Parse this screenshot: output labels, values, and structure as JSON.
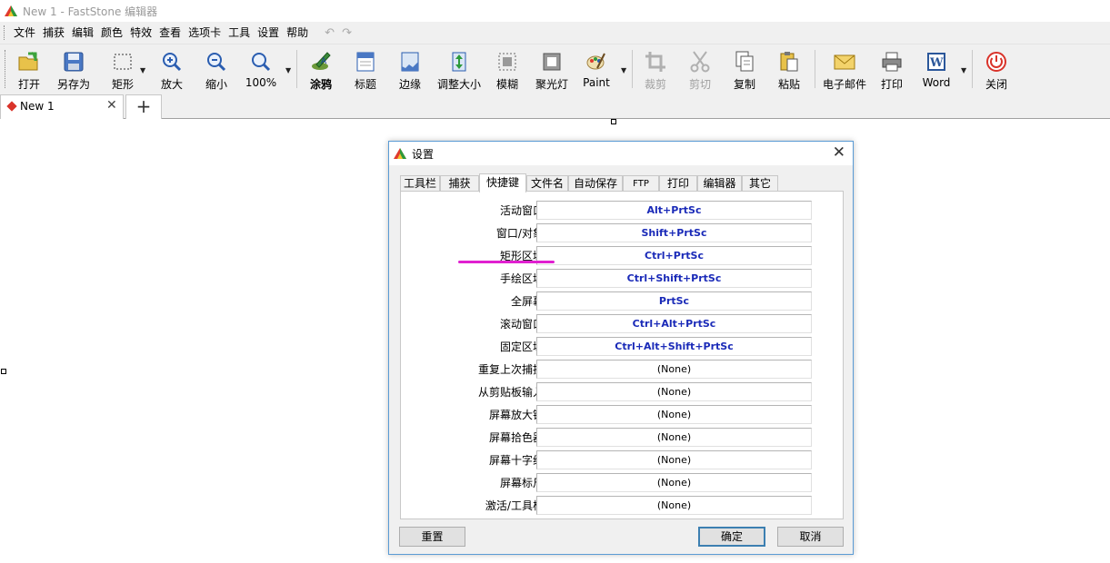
{
  "window": {
    "title": "New 1 - FastStone 编辑器"
  },
  "menu": [
    "文件",
    "捕获",
    "编辑",
    "颜色",
    "特效",
    "查看",
    "选项卡",
    "工具",
    "设置",
    "帮助"
  ],
  "toolbar": {
    "open": "打开",
    "save_as": "另存为",
    "rect": "矩形",
    "zoom_in": "放大",
    "zoom_out": "缩小",
    "zoom_level": "100%",
    "draw": "涂鸦",
    "caption": "标题",
    "edge": "边缘",
    "resize": "调整大小",
    "blur": "模糊",
    "spotlight": "聚光灯",
    "paint": "Paint",
    "crop": "裁剪",
    "cut": "剪切",
    "copy": "复制",
    "paste": "粘贴",
    "email": "电子邮件",
    "print": "打印",
    "word": "Word",
    "close": "关闭"
  },
  "tabs": {
    "doc_name": "New 1",
    "close_glyph": "✕",
    "add_glyph": "+"
  },
  "dialog": {
    "title": "设置",
    "close_glyph": "✕",
    "tabs": [
      "工具栏",
      "捕获",
      "快捷键",
      "文件名",
      "自动保存",
      "FTP",
      "打印",
      "编辑器",
      "其它"
    ],
    "active_tab": "快捷键",
    "shortcuts": [
      {
        "label": "活动窗口:",
        "value": "Alt+PrtSc"
      },
      {
        "label": "窗口/对象:",
        "value": "Shift+PrtSc"
      },
      {
        "label": "矩形区域:",
        "value": "Ctrl+PrtSc"
      },
      {
        "label": "手绘区域:",
        "value": "Ctrl+Shift+PrtSc"
      },
      {
        "label": "全屏幕:",
        "value": "PrtSc"
      },
      {
        "label": "滚动窗口:",
        "value": "Ctrl+Alt+PrtSc"
      },
      {
        "label": "固定区域:",
        "value": "Ctrl+Alt+Shift+PrtSc"
      },
      {
        "label": "重复上次捕捉:",
        "value": "(None)"
      },
      {
        "label": "从剪贴板输入:",
        "value": "(None)"
      },
      {
        "label": "屏幕放大镜:",
        "value": "(None)"
      },
      {
        "label": "屏幕拾色器:",
        "value": "(None)"
      },
      {
        "label": "屏幕十字线:",
        "value": "(None)"
      },
      {
        "label": "屏幕标尺:",
        "value": "(None)"
      },
      {
        "label": "激活/工具栏:",
        "value": "(None)"
      }
    ],
    "buttons": {
      "reset": "重置",
      "ok": "确定",
      "cancel": "取消"
    }
  },
  "colors": {
    "shortcut_text": "#1a2ab8",
    "annotation": "#e020d0",
    "dialog_border": "#5a9bd5"
  }
}
